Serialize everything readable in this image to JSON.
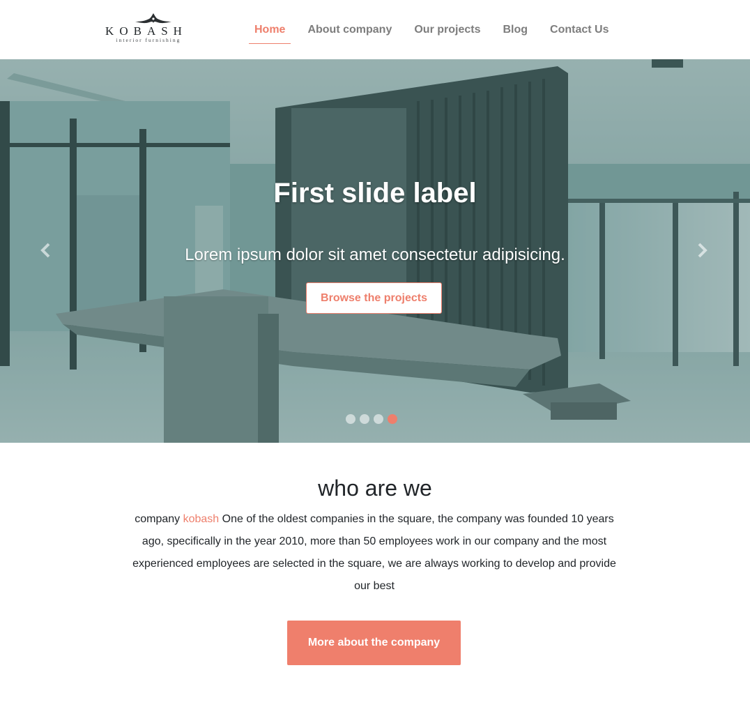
{
  "brand": {
    "name": "KOBASH",
    "tagline": "interior furnishing"
  },
  "nav": {
    "items": [
      {
        "label": "Home",
        "active": true
      },
      {
        "label": "About company",
        "active": false
      },
      {
        "label": "Our projects",
        "active": false
      },
      {
        "label": "Blog",
        "active": false
      },
      {
        "label": "Contact Us",
        "active": false
      }
    ]
  },
  "carousel": {
    "title": "First slide label",
    "text": "Lorem ipsum dolor sit amet consectetur adipisicing.",
    "button_label": "Browse the projects",
    "indicator_count": 4,
    "active_indicator": 4,
    "prev_icon": "chevron-left-icon",
    "next_icon": "chevron-right-icon"
  },
  "about": {
    "title": "who are we",
    "text_before": "company ",
    "highlight": "kobash",
    "text_after": " One of the oldest companies in the square, the company was founded 10 years ago, specifically in the year 2010, more than 50 employees work in our company and the most experienced employees are selected in the square, we are always working to develop and provide our best",
    "button_label": "More about the company"
  },
  "colors": {
    "accent": "#ee7f6c",
    "nav_text": "#7d7d7d",
    "text": "#212529"
  }
}
